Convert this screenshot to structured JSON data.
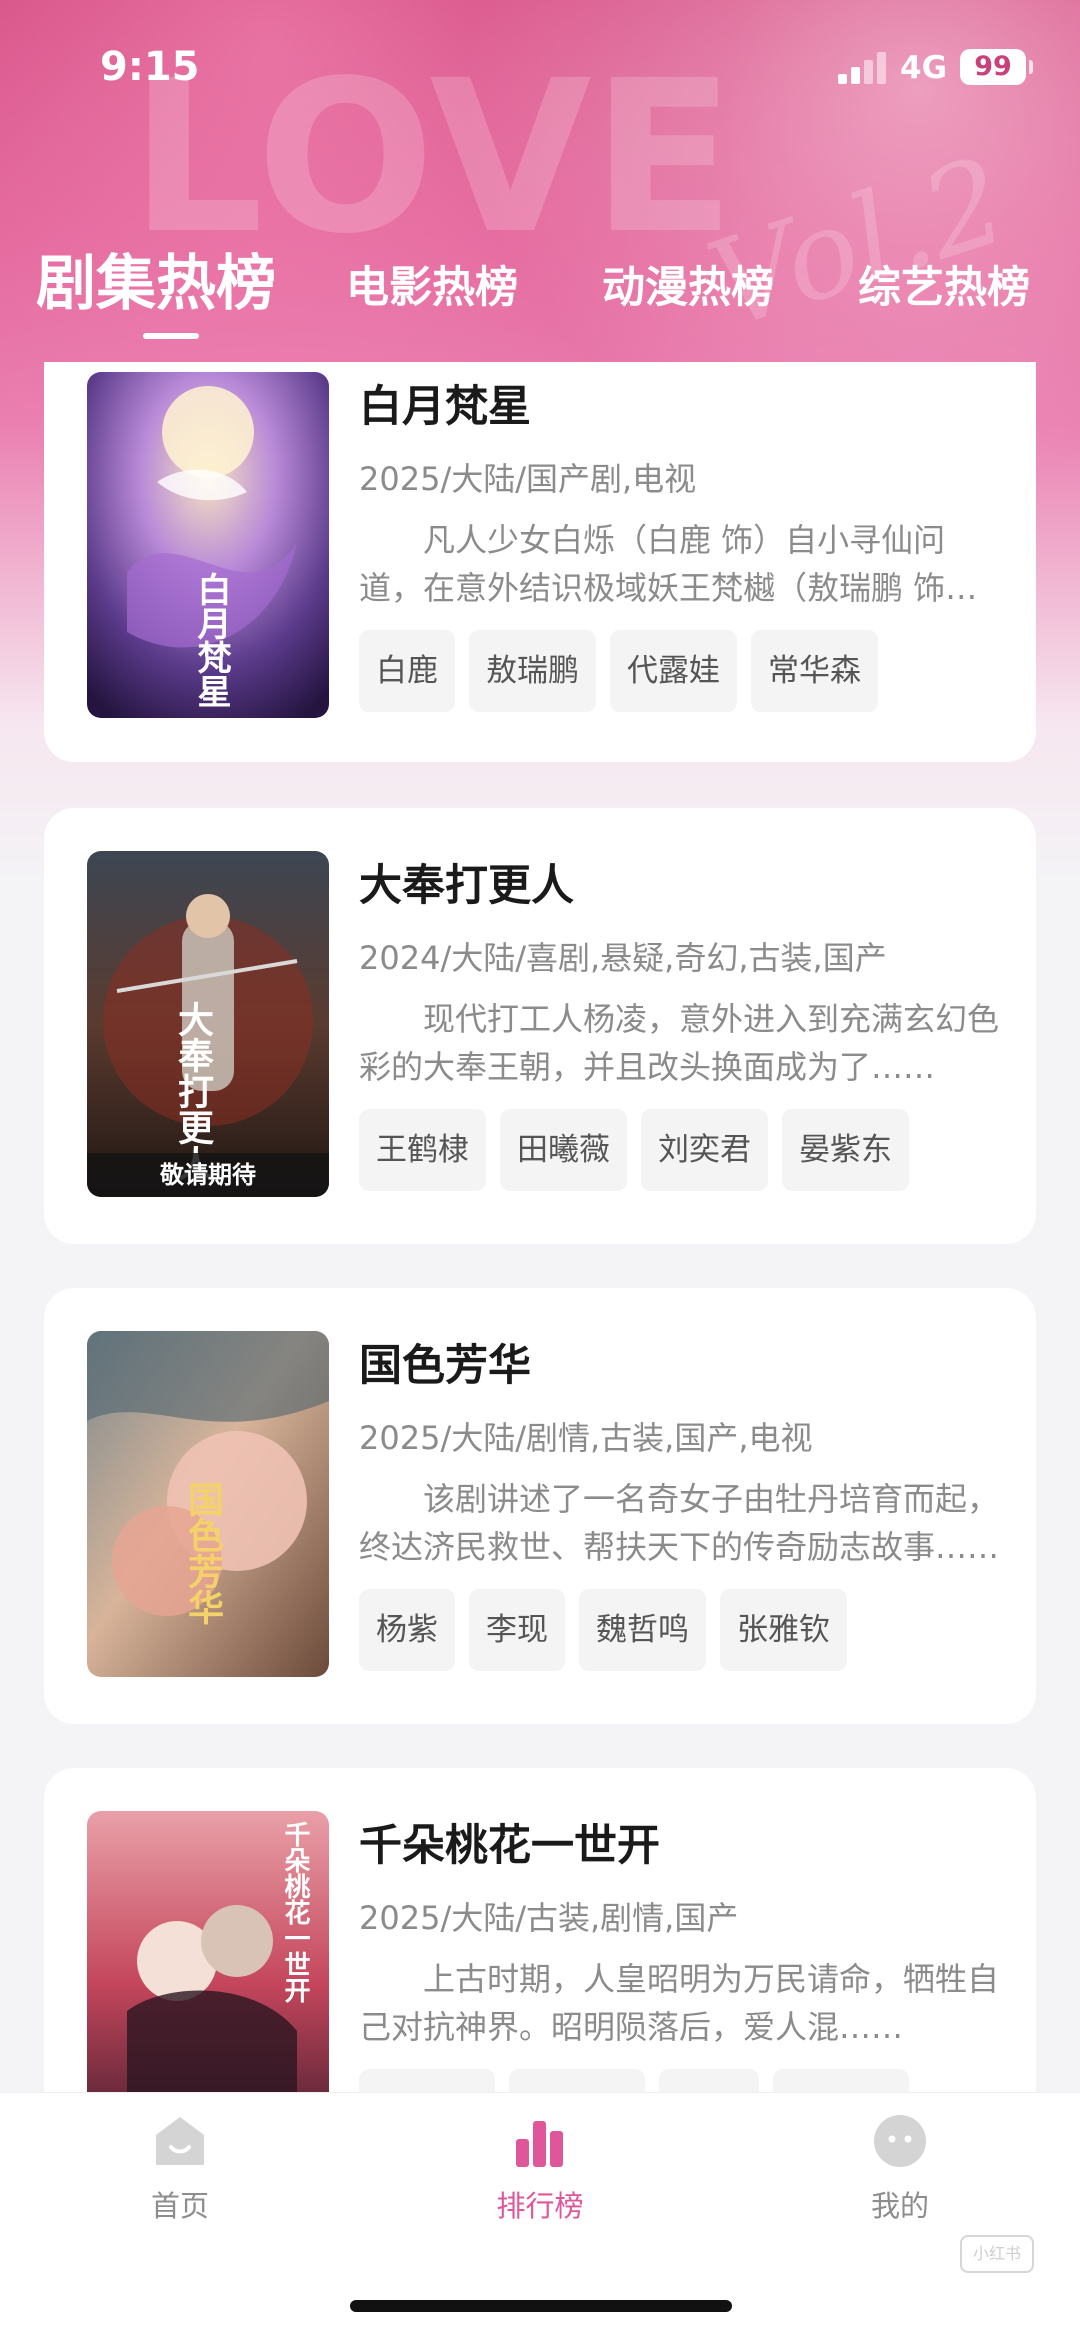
{
  "status_bar": {
    "time": "9:15",
    "network": "4G",
    "battery": "99"
  },
  "tabs": [
    {
      "label": "剧集热榜",
      "active": true
    },
    {
      "label": "电影热榜",
      "active": false
    },
    {
      "label": "动漫热榜",
      "active": false
    },
    {
      "label": "综艺热榜",
      "active": false
    }
  ],
  "shows": [
    {
      "title": "白月梵星",
      "meta": "2025/大陆/国产剧,电视",
      "description": "凡人少女白烁（白鹿 饰）自小寻仙问道，在意外结识极域妖王梵樾（敖瑞鹏 饰）后……",
      "cast": [
        "白鹿",
        "敖瑞鹏",
        "代露娃",
        "常华森"
      ],
      "poster_text": "白月梵星"
    },
    {
      "title": "大奉打更人",
      "meta": "2024/大陆/喜剧,悬疑,奇幻,古装,国产",
      "description": "现代打工人杨凌，意外进入到充满玄幻色彩的大奉王朝，并且改头换面成为了……",
      "cast": [
        "王鹤棣",
        "田曦薇",
        "刘奕君",
        "晏紫东"
      ],
      "poster_text": "大奉打更人",
      "poster_band": "敬请期待"
    },
    {
      "title": "国色芳华",
      "meta": "2025/大陆/剧情,古装,国产,电视",
      "description": "该剧讲述了一名奇女子由牡丹培育而起，终达济民救世、帮扶天下的传奇励志故事……",
      "cast": [
        "杨紫",
        "李现",
        "魏哲鸣",
        "张雅钦"
      ],
      "poster_text": "国色芳华"
    },
    {
      "title": "千朵桃花一世开",
      "meta": "2025/大陆/古装,剧情,国产",
      "description": "上古时期，人皇昭明为万民请命，牺牲自己对抗神界。昭明陨落后，爱人混……",
      "cast": [
        "",
        "",
        "",
        ""
      ],
      "poster_text": "千朵桃花一世开"
    }
  ],
  "tabbar": [
    {
      "label": "首页",
      "icon": "home-icon",
      "active": false
    },
    {
      "label": "排行榜",
      "icon": "ranking-icon",
      "active": true
    },
    {
      "label": "我的",
      "icon": "profile-icon",
      "active": false
    }
  ],
  "colors": {
    "accent": "#e0569a",
    "header_pink": "#d2487f",
    "text_primary": "#1a1a1a",
    "text_secondary": "#8b8b8b"
  }
}
